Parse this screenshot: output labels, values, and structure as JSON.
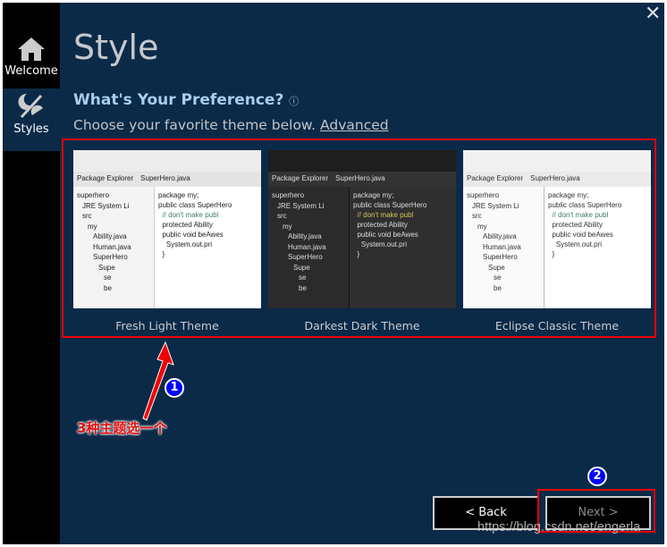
{
  "sidebar": {
    "items": [
      {
        "label": "Welcome",
        "icon": "home-icon"
      },
      {
        "label": "Styles",
        "icon": "theme-icon",
        "selected": true
      }
    ]
  },
  "main": {
    "title": "Style",
    "heading": "What's Your Preference?",
    "subtitle": "Choose your favorite theme below.",
    "advanced_link": "Advanced",
    "themes": [
      {
        "label": "Fresh Light Theme",
        "style": "light"
      },
      {
        "label": "Darkest Dark Theme",
        "style": "dark"
      },
      {
        "label": "Eclipse Classic Theme",
        "style": "classic"
      }
    ],
    "preview": {
      "explorer_tab": "Package Explorer",
      "editor_tab": "SuperHero.java",
      "tree": [
        "superhero",
        "JRE System Li",
        "src",
        "my",
        "Ability.java",
        "Human.java",
        "SuperHero",
        "Supe",
        "se",
        "be"
      ],
      "code": [
        "package my;",
        "",
        "public class SuperHero",
        "",
        "  // don't make publ",
        "  protected Ability",
        "",
        "  public void beAwes",
        "    System.out.pri",
        "  }"
      ]
    },
    "back_label": "< Back",
    "next_label": "Next >"
  },
  "annotations": {
    "marker1": "1",
    "marker2": "2",
    "note": "3种主题选一个",
    "watermark": "https://blog.csdn.net/engerla",
    "color": "#e00000"
  },
  "colors": {
    "background": "#0b2a48",
    "sidebar": "#000000",
    "heading": "#a8cdf0"
  }
}
